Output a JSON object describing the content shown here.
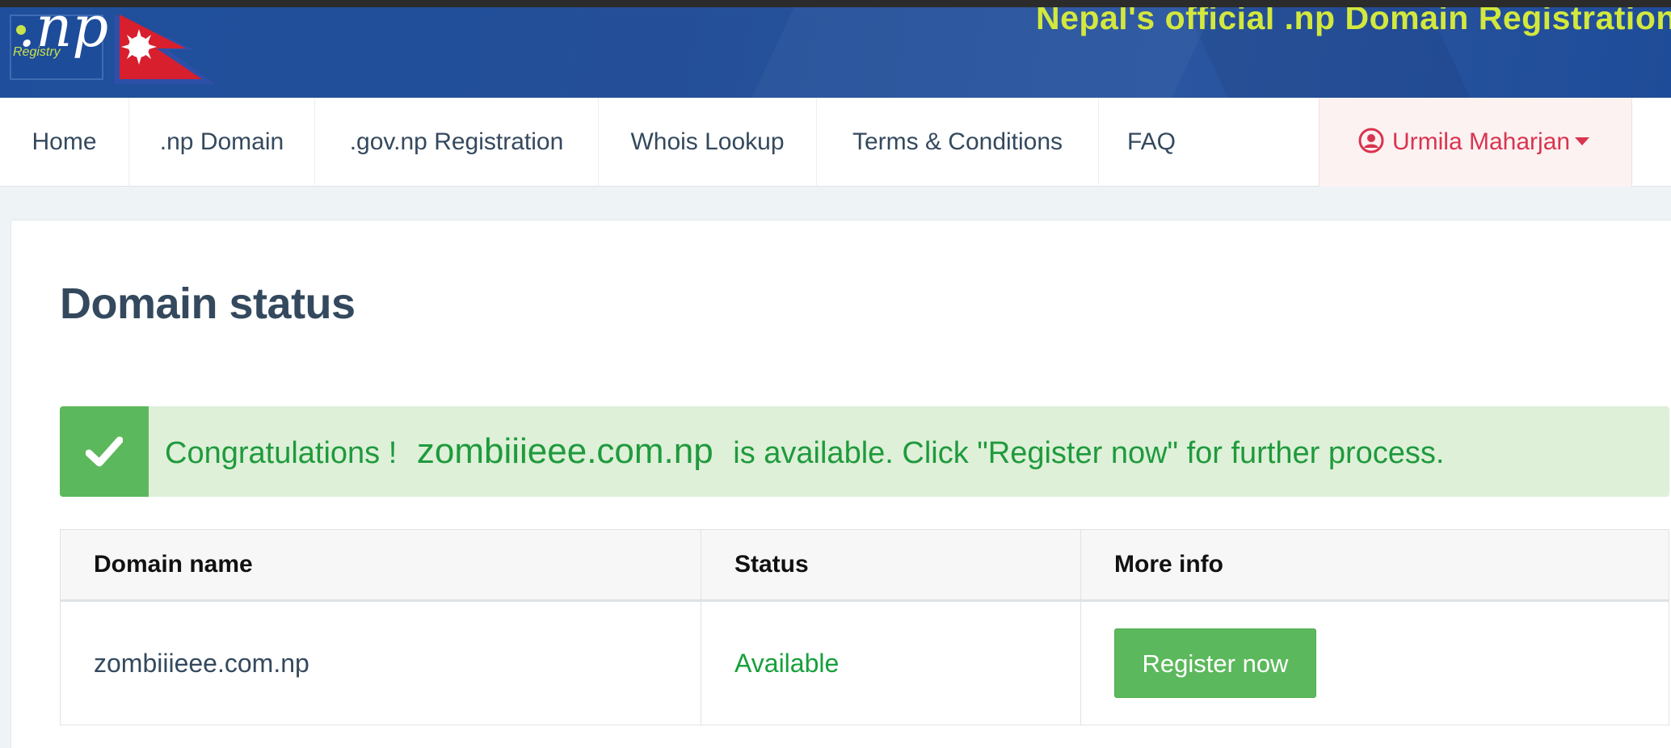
{
  "banner": {
    "logo_np": ".np",
    "logo_registry": "Registry",
    "title": "Nepal's official .np Domain Registration"
  },
  "nav": {
    "items": [
      {
        "label": "Home"
      },
      {
        "label": ".np Domain"
      },
      {
        "label": ".gov.np Registration"
      },
      {
        "label": "Whois Lookup"
      },
      {
        "label": "Terms & Conditions"
      },
      {
        "label": "FAQ"
      }
    ],
    "user": {
      "name": "Urmila Maharjan",
      "icon": "user-circle-icon"
    }
  },
  "main": {
    "title": "Domain status",
    "alert": {
      "prefix": "Congratulations !",
      "domain": "zombiiieee.com.np",
      "suffix": "is available. Click \"Register now\" for further process.",
      "icon": "check-icon"
    },
    "table": {
      "headers": [
        "Domain name",
        "Status",
        "More info"
      ],
      "rows": [
        {
          "domain": "zombiiieee.com.np",
          "status": "Available",
          "action": "Register now"
        }
      ]
    }
  },
  "colors": {
    "banner_blue": "#1f4f9c",
    "banner_title": "#d3e83d",
    "success_green": "#5cb85c",
    "alert_bg": "#def0d8",
    "status_text_green": "#16a03b",
    "user_red": "#d9344f"
  }
}
